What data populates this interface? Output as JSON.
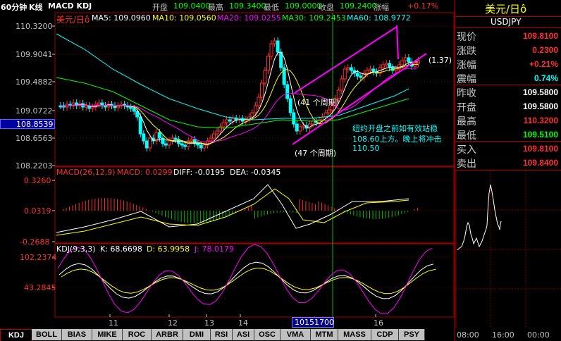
{
  "header": {
    "period": "60分钟",
    "chart_kind": "K线",
    "indicators": "MACD KDJ",
    "open_label": "开盘",
    "open_value": "109.0400",
    "high_label": "最高",
    "high_value": "109.3400",
    "low_label": "最低",
    "low_value": "109.0000",
    "close_label": "收盘",
    "close_value": "109.2400",
    "change_label": "涨幅",
    "change_value": "+0.17%"
  },
  "legend": {
    "symbol": "美元/日ô",
    "ma5": "MA5: 109.0960",
    "ma10": "MA10: 109.0560",
    "ma20": "MA20: 109.0255",
    "ma30": "MA30: 109.2453",
    "ma60": "MA60: 108.9772"
  },
  "price_axis": {
    "ticks": [
      "110.3200",
      "109.9041",
      "109.4882",
      "109.0722",
      "108.6563",
      "108.2203"
    ],
    "current_marker": "108.8539"
  },
  "annotations": {
    "ratio": "(1.37)",
    "period_upper": "(41 个周期)",
    "period_lower": "(47 个周期)",
    "comment_line1": "纽约开盘之前如有效站稳",
    "comment_line2": "108.60上方。晚上将冲击",
    "comment_line3": "110.50"
  },
  "macd": {
    "title": "MACD(26,12,9)",
    "macd_value": "MACD: 0.0299",
    "diff_value": "DIFF: -0.0195",
    "dea_value": "DEA: -0.0345",
    "ticks": [
      "0.3260",
      "0.0319",
      "-0.2688"
    ]
  },
  "kdj": {
    "title": "KDJ(9,3,3)",
    "k_value": "K: 68.6698",
    "d_value": "D: 63.9958",
    "j_value": "J: 78.0179",
    "ticks": [
      "102.2374",
      "43.2845"
    ]
  },
  "time_axis": {
    "labels": [
      "11",
      "12",
      "13",
      "14",
      "16"
    ],
    "cursor_label": "10151700"
  },
  "quote": {
    "title": "美元/日ô",
    "code": "USDJPY",
    "rows": [
      {
        "label": "现价",
        "value": "109.8100",
        "color": "#ff3030"
      },
      {
        "label": "涨跌",
        "value": "0.2300",
        "color": "#ff3030"
      },
      {
        "label": "涨幅",
        "value": "+0.21%",
        "color": "#ff3030"
      },
      {
        "label": "震幅",
        "value": "0.74%",
        "color": "#00ffff"
      },
      {
        "label": "昨收",
        "value": "109.5800",
        "color": "#ffffff"
      },
      {
        "label": "开盘",
        "value": "109.5800",
        "color": "#ffffff"
      },
      {
        "label": "最高",
        "value": "110.3200",
        "color": "#ff3030"
      },
      {
        "label": "最低",
        "value": "109.5100",
        "color": "#00ff00"
      },
      {
        "label": "买入",
        "value": "109.8100",
        "color": "#ff3030"
      },
      {
        "label": "卖出",
        "value": "109.8400",
        "color": "#ff3030"
      }
    ],
    "mini_times": [
      "08:00",
      "16:00",
      "00:00"
    ]
  },
  "tabs": [
    "KDJ",
    "BOLL",
    "BIAS",
    "MIKE",
    "ROC",
    "ARBR",
    "DMI",
    "RSI",
    "ASI",
    "OSC",
    "VMA",
    "MTM",
    "MASS",
    "CDP",
    "PSY"
  ],
  "colors": {
    "up": "#ff3030",
    "down": "#00ffff",
    "channel": "#ff00ff",
    "ma5": "#ffffff",
    "ma10": "#ffff00",
    "ma20": "#ff00ff",
    "ma30": "#00ff00",
    "ma60": "#00ffff"
  }
}
